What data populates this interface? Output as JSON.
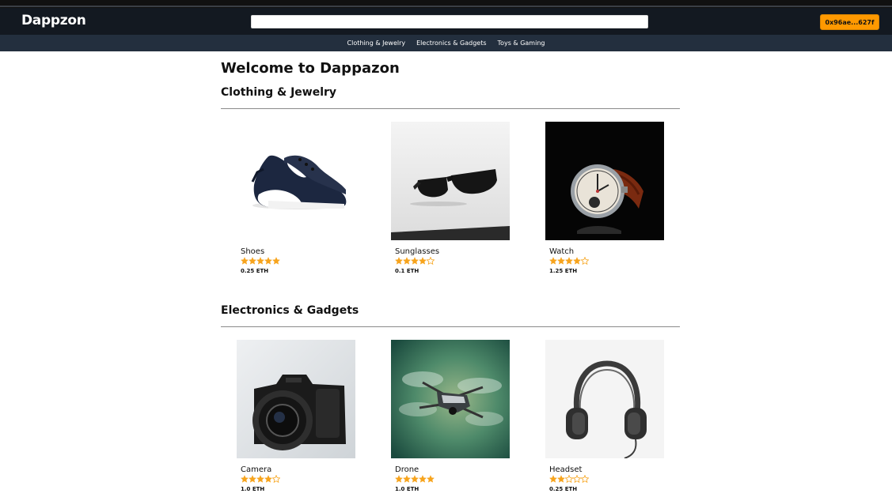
{
  "app": {
    "brand": "Dappzon",
    "account_button": "0x96ae...627f"
  },
  "search": {
    "placeholder": "",
    "value": ""
  },
  "categories_nav": [
    "Clothing & Jewelry",
    "Electronics & Gadgets",
    "Toys & Gaming"
  ],
  "main": {
    "title": "Welcome to Dappazon"
  },
  "sections": [
    {
      "title": "Clothing & Jewelry",
      "items": [
        {
          "name": "Shoes",
          "rating": 5,
          "price": "0.25 ETH",
          "image": "shoe-image"
        },
        {
          "name": "Sunglasses",
          "rating": 4,
          "price": "0.1 ETH",
          "image": "sunglasses-image"
        },
        {
          "name": "Watch",
          "rating": 4,
          "price": "1.25 ETH",
          "image": "watch-image"
        }
      ]
    },
    {
      "title": "Electronics & Gadgets",
      "items": [
        {
          "name": "Camera",
          "rating": 4,
          "price": "1.0 ETH",
          "image": "camera-image"
        },
        {
          "name": "Drone",
          "rating": 5,
          "price": "1.0 ETH",
          "image": "drone-image"
        },
        {
          "name": "Headset",
          "rating": 2,
          "price": "0.25 ETH",
          "image": "headset-image"
        }
      ]
    }
  ],
  "colors": {
    "navbar": "#131921",
    "subnav": "#232f3e",
    "accent": "#ff9900",
    "star": "#f7a41d"
  }
}
